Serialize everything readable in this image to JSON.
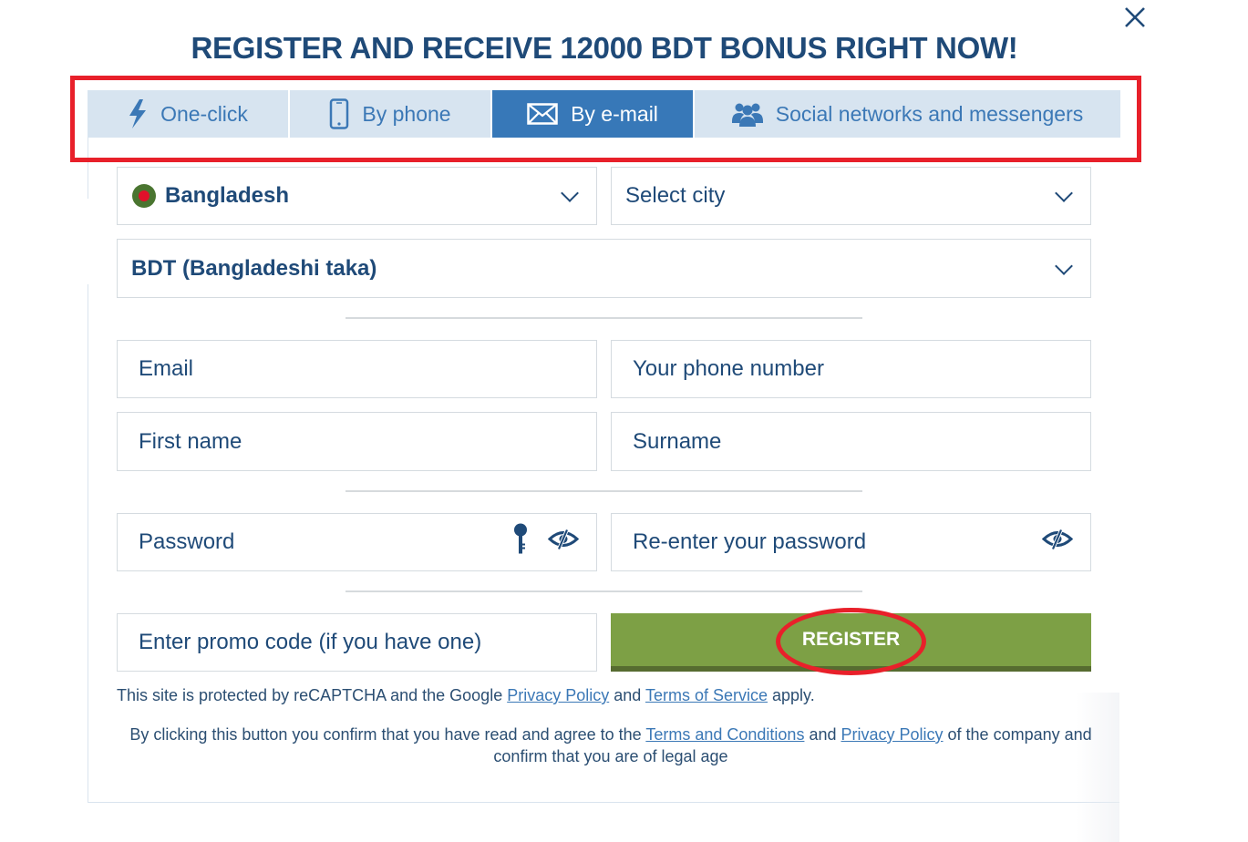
{
  "header": {
    "title": "REGISTER AND RECEIVE 12000 BDT BONUS RIGHT NOW!",
    "close_icon": "close-icon"
  },
  "tabs": [
    {
      "label": "One-click",
      "icon": "lightning-icon",
      "active": false
    },
    {
      "label": "By phone",
      "icon": "mobile-phone-icon",
      "active": false
    },
    {
      "label": "By e-mail",
      "icon": "envelope-icon",
      "active": true
    },
    {
      "label": "Social networks and messengers",
      "icon": "users-group-icon",
      "active": false
    }
  ],
  "form": {
    "country": {
      "value": "Bangladesh",
      "flag": "bangladesh-flag-icon"
    },
    "city": {
      "placeholder": "Select city"
    },
    "currency": {
      "value": "BDT (Bangladeshi taka)"
    },
    "email": {
      "placeholder": "Email"
    },
    "phone": {
      "placeholder": "Your phone number"
    },
    "first_name": {
      "placeholder": "First name"
    },
    "surname": {
      "placeholder": "Surname"
    },
    "password": {
      "placeholder": "Password",
      "icons": [
        "key-icon",
        "eye-slash-icon"
      ]
    },
    "password_confirm": {
      "placeholder": "Re-enter your password",
      "icons": [
        "eye-slash-icon"
      ]
    },
    "promo": {
      "placeholder": "Enter promo code (if you have one)"
    },
    "register_label": "REGISTER"
  },
  "legal": {
    "recaptcha_prefix": "This site is protected by reCAPTCHA and the Google ",
    "recaptcha_privacy": "Privacy Policy",
    "recaptcha_and": " and ",
    "recaptcha_terms": "Terms of Service",
    "recaptcha_suffix": " apply.",
    "agree_prefix": "By clicking this button you confirm that you have read and agree to the ",
    "agree_terms": "Terms and Conditions",
    "agree_and": " and ",
    "agree_privacy": "Privacy Policy",
    "agree_suffix": " of the company and confirm that you are of legal age"
  },
  "colors": {
    "primary_text": "#1f4a78",
    "tab_active_bg": "#3778b8",
    "tab_inactive_bg": "#d7e4f0",
    "register_bg": "#7da045",
    "annotation_red": "#e8202a"
  }
}
